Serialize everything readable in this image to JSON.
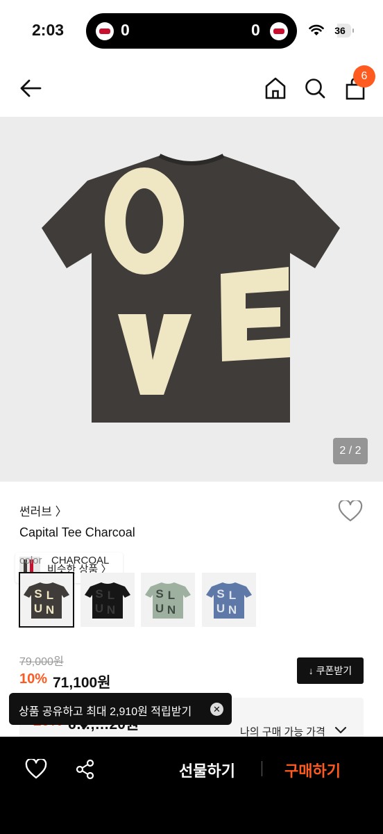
{
  "status_bar": {
    "time": "2:03",
    "score_left": "0",
    "score_right": "0",
    "battery": "36",
    "battery_level": 0.36
  },
  "header": {
    "cart_count": "6"
  },
  "hero": {
    "similar_label": "비슷한 상품 〉",
    "page_counter": "2 / 2",
    "graphic_letters": [
      "O",
      "V",
      "E"
    ]
  },
  "product": {
    "brand": "썬러브 〉",
    "title": "Capital Tee Charcoal",
    "color_label": "color",
    "color_value": "CHARCOAL",
    "swatch_letters": [
      "S",
      "L",
      "U",
      "N"
    ],
    "swatches": [
      {
        "name": "charcoal",
        "shirt": "#3f3c39",
        "print": "#efe6c4",
        "selected": true
      },
      {
        "name": "black",
        "shirt": "#161616",
        "print": "#3a3a3a",
        "selected": false
      },
      {
        "name": "sage",
        "shirt": "#9eb0a0",
        "print": "#3f4a42",
        "selected": false
      },
      {
        "name": "blue",
        "shirt": "#5e79a8",
        "print": "#dfe3ea",
        "selected": false
      }
    ]
  },
  "price": {
    "original": "79,000원",
    "discount": "10%",
    "sale": "71,100원",
    "coupon_label": "↓ 쿠폰받기",
    "my_price_label": "나의 구매 가능 가격",
    "partial_discount": "20%",
    "partial_price": "6…,…20원"
  },
  "toast": {
    "message": "상품 공유하고 최대 2,910원 적립받기"
  },
  "bottom": {
    "gift_label": "선물하기",
    "buy_label": "구매하기"
  },
  "colors": {
    "accent": "#ff5a1f",
    "tee": "#3f3c39",
    "patch": "#efe6c4"
  }
}
